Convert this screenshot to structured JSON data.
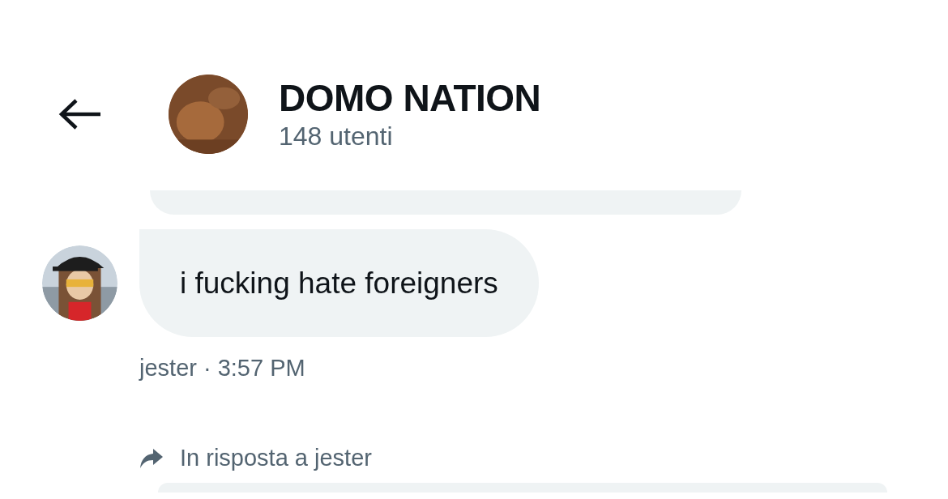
{
  "header": {
    "title": "DOMO NATION",
    "subtitle": "148 utenti"
  },
  "messages": [
    {
      "kind": "partial"
    },
    {
      "kind": "message",
      "text": "i fucking hate foreigners",
      "meta": "jester · 3:57 PM"
    },
    {
      "kind": "reply",
      "reply_to": "In risposta a jester"
    }
  ]
}
